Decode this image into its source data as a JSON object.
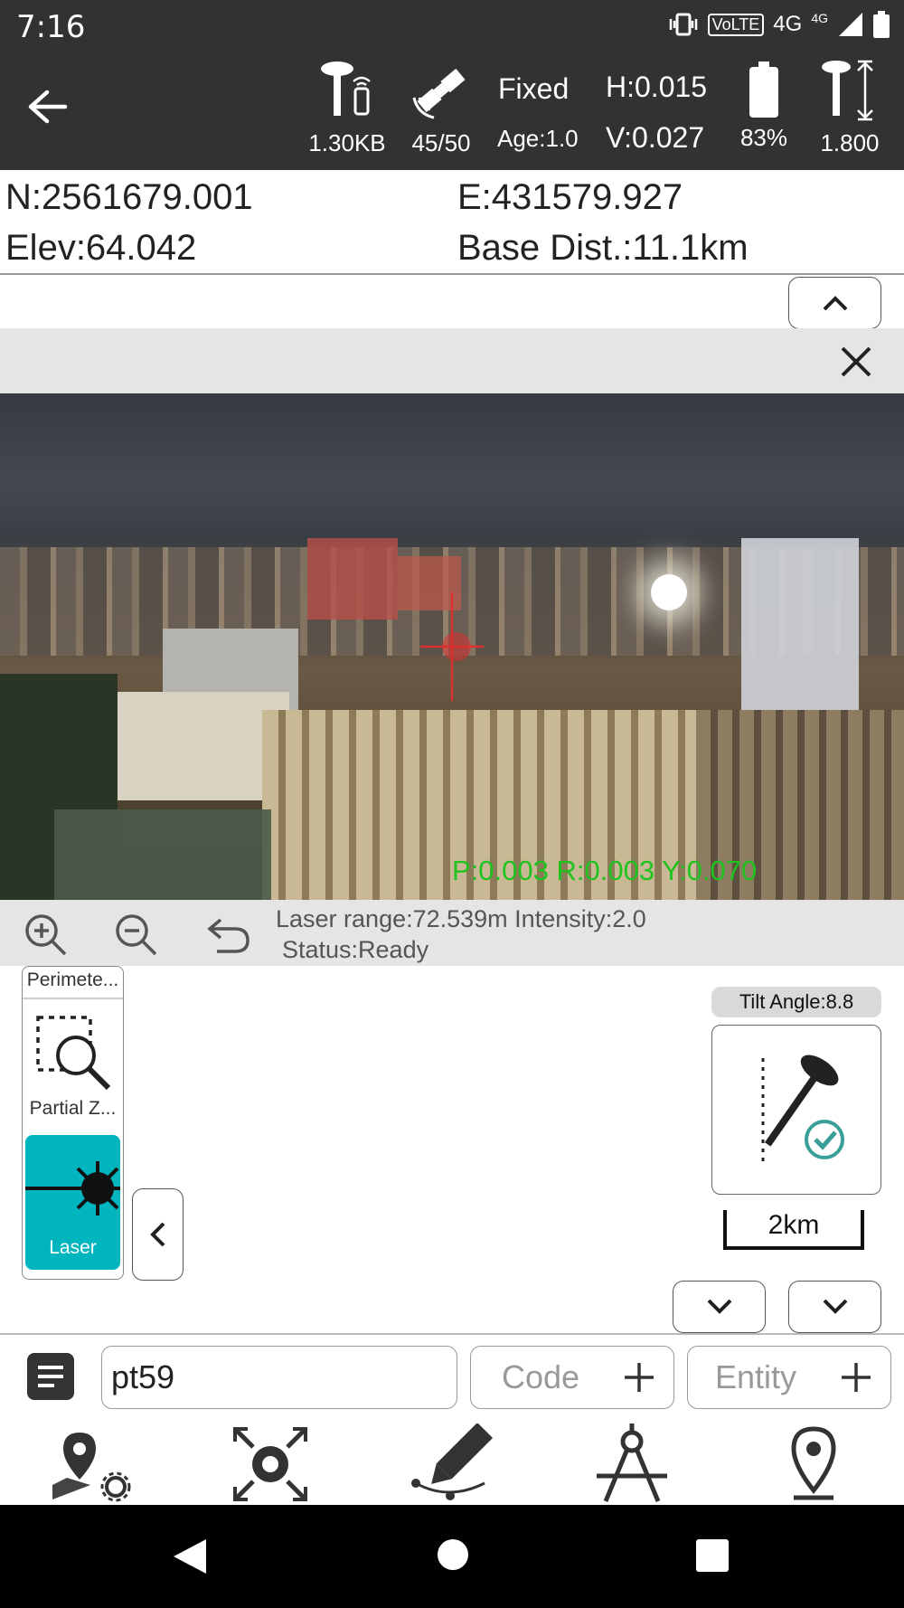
{
  "status_bar": {
    "time": "7:16",
    "volte": "VoLTE",
    "network": "4G",
    "network_small": "4G"
  },
  "top_bar": {
    "data_rate": "1.30KB",
    "satellites": "45/50",
    "fix_status": "Fixed",
    "age": "Age:1.0",
    "h_precision": "H:0.015",
    "v_precision": "V:0.027",
    "battery": "83%",
    "antenna_height": "1.800"
  },
  "coordinates": {
    "north": "N:2561679.001",
    "east": "E:431579.927",
    "elevation": "Elev:64.042",
    "base_distance": "Base Dist.:11.1km"
  },
  "camera": {
    "attitude": "P:0.003 R:0.003 Y:0.070"
  },
  "laser_info": {
    "range_line": "Laser range:72.539m Intensity:2.0",
    "status_line": "Status:Ready"
  },
  "tool_panel": {
    "items": [
      {
        "label": "Perimete..."
      },
      {
        "label": "Partial Z..."
      },
      {
        "label": "Laser"
      }
    ]
  },
  "tilt": {
    "label": "Tilt Angle:8.8"
  },
  "scale": {
    "label": "2km"
  },
  "input": {
    "point_name": "pt59",
    "code_placeholder": "Code",
    "entity_placeholder": "Entity"
  },
  "colors": {
    "dark_bar": "#323232",
    "laser_active": "#00b5bd",
    "attitude_text": "#1ec31e"
  }
}
